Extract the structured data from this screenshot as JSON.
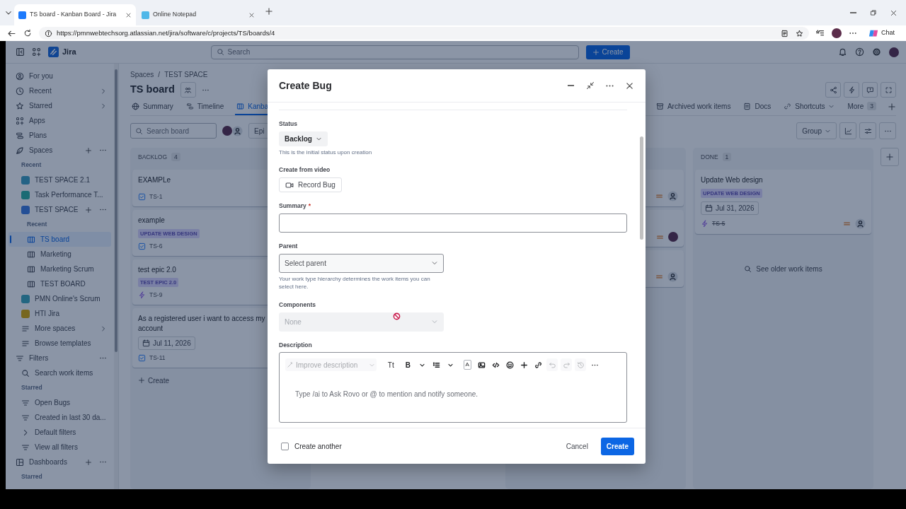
{
  "browser": {
    "tabs": [
      {
        "title": "TS board - Kanban Board - Jira",
        "selected": true
      },
      {
        "title": "Online Notepad",
        "selected": false
      }
    ],
    "url": "https://pmnwebtechsorg.atlassian.net/jira/software/c/projects/TS/boards/4",
    "chat_label": "Chat"
  },
  "topnav": {
    "product": "Jira",
    "search_placeholder": "Search",
    "create_label": "Create"
  },
  "sidebar": {
    "items": [
      {
        "kind": "for-you",
        "label": "For you"
      },
      {
        "kind": "recent",
        "label": "Recent",
        "chevron": true
      },
      {
        "kind": "starred",
        "label": "Starred",
        "chevron": true
      },
      {
        "kind": "apps",
        "label": "Apps"
      },
      {
        "kind": "plans",
        "label": "Plans"
      },
      {
        "kind": "spaces",
        "label": "Spaces",
        "add": true,
        "more": true,
        "children": [
          {
            "kind": "heading",
            "label": "Recent"
          },
          {
            "kind": "space",
            "label": "TEST SPACE 2.1",
            "color": "#236285"
          },
          {
            "kind": "space",
            "label": "Task Performance T...",
            "color": "#1a6b74"
          },
          {
            "kind": "space",
            "label": "TEST SPACE",
            "color": "#244f96",
            "add": true,
            "more": true,
            "children": [
              {
                "kind": "heading",
                "label": "Recent"
              },
              {
                "kind": "board",
                "label": "TS board",
                "selected": true
              },
              {
                "kind": "board",
                "label": "Marketing",
                "selected": false
              },
              {
                "kind": "board",
                "label": "Marketing Scrum",
                "selected": false
              },
              {
                "kind": "board",
                "label": "TEST BOARD",
                "selected": false
              }
            ]
          },
          {
            "kind": "space",
            "label": "PMN Online's Scrum",
            "color": "#236681"
          },
          {
            "kind": "space",
            "label": "HTI Jira",
            "color": "#77671f"
          },
          {
            "kind": "menu",
            "label": "More spaces",
            "chevron": true
          },
          {
            "kind": "menu",
            "label": "Browse templates"
          }
        ]
      },
      {
        "kind": "filters",
        "label": "Filters",
        "more": true,
        "children": [
          {
            "kind": "search",
            "label": "Search work items"
          },
          {
            "kind": "heading",
            "label": "Starred"
          },
          {
            "kind": "filter",
            "label": "Open Bugs"
          },
          {
            "kind": "filter",
            "label": "Created in last 30 da..."
          },
          {
            "kind": "expander",
            "label": "Default filters"
          },
          {
            "kind": "filter",
            "label": "View all filters"
          }
        ]
      },
      {
        "kind": "dashboards",
        "label": "Dashboards",
        "add": true,
        "more": true,
        "children": [
          {
            "kind": "heading",
            "label": "Starred"
          }
        ]
      }
    ]
  },
  "board": {
    "breadcrumb": [
      "Spaces",
      "TEST SPACE"
    ],
    "breadcrumb_separator": "/",
    "title": "TS board",
    "tabs": [
      {
        "label": "Summary",
        "kind": "summary",
        "selected": false
      },
      {
        "label": "Timeline",
        "kind": "timeline",
        "selected": false
      },
      {
        "label": "Kanba",
        "kind": "board",
        "selected": true
      }
    ],
    "tabs_right": [
      {
        "label": "Archived work items",
        "kind": "archive"
      },
      {
        "label": "Docs",
        "kind": "docs"
      },
      {
        "label": "Shortcuts",
        "kind": "shortcuts",
        "dropdown": true
      },
      {
        "label": "More",
        "kind": "more",
        "count": "3"
      }
    ],
    "search_placeholder": "Search board",
    "filter_avatars": [
      {
        "kind": "user"
      },
      {
        "kind": "unassigned"
      }
    ],
    "filter_label": "Epi",
    "group_label": "Group"
  },
  "columns": [
    {
      "title": "BACKLOG",
      "count": "4",
      "create_label": "Create",
      "cards": [
        {
          "summary": "EXAMPLe",
          "kind": "task",
          "key": "TS-1",
          "done": false
        },
        {
          "summary": "example",
          "epic": "UPDATE WEB DESIGN",
          "kind": "task",
          "key": "TS-6",
          "done": false
        },
        {
          "summary": "test epic 2.0",
          "epic": "TEST EPIC 2.0",
          "kind": "epic",
          "key": "TS-9",
          "done": false
        },
        {
          "summary": "As a registered user i want to access my account",
          "due": "Jul 11, 2026",
          "kind": "task",
          "key": "TS-11",
          "done": false
        }
      ]
    },
    {
      "cards": [
        {
          "has_priority": true,
          "assigned": false
        },
        {
          "has_priority": true,
          "assigned": true
        },
        {
          "has_priority": true,
          "assigned": false
        }
      ]
    },
    {
      "title": "DONE",
      "count": "1",
      "footer_link": "See older work items",
      "cards": [
        {
          "summary": "Update Web design",
          "epic": "UPDATE WEB DESIGN",
          "due": "Jul 31, 2026",
          "kind": "epic",
          "key": "TS-5",
          "done": true,
          "has_priority": true,
          "assigned": false
        }
      ]
    }
  ],
  "dialog": {
    "title": "Create Bug",
    "fields": [
      {
        "kind": "status",
        "label": "Status",
        "value": "Backlog",
        "help": "This is the initial status upon creation"
      },
      {
        "kind": "video",
        "label": "Create from video",
        "button": "Record Bug"
      },
      {
        "kind": "text",
        "label": "Summary",
        "required_mark": "*"
      },
      {
        "kind": "select",
        "label": "Parent",
        "placeholder": "Select parent",
        "disabled": false,
        "help": "Your work type hierarchy determines the work items you can select here."
      },
      {
        "kind": "select",
        "label": "Components",
        "value": "None",
        "disabled": true
      },
      {
        "kind": "editor",
        "label": "Description",
        "placeholder": "Type /ai to Ask Rovo or @ to mention and notify someone.",
        "toolbar": [
          {
            "kind": "ai",
            "label": "Improve description",
            "disabled": true
          },
          {
            "kind": "text",
            "label": "Tt",
            "disabled": false
          },
          {
            "kind": "text",
            "label": "B",
            "disabled": false
          },
          {
            "kind": "caret",
            "disabled": false
          },
          {
            "kind": "list",
            "disabled": false
          },
          {
            "kind": "caret",
            "disabled": false
          },
          {
            "kind": "text-color",
            "label": "A",
            "disabled": false
          },
          {
            "kind": "image",
            "disabled": false
          },
          {
            "kind": "code",
            "disabled": false
          },
          {
            "kind": "emoji",
            "disabled": false
          },
          {
            "kind": "insert",
            "disabled": false
          },
          {
            "kind": "link",
            "disabled": false
          },
          {
            "kind": "undo",
            "disabled": true
          },
          {
            "kind": "redo",
            "disabled": true
          },
          {
            "kind": "history",
            "disabled": true
          },
          {
            "kind": "more",
            "disabled": false
          }
        ]
      }
    ],
    "create_another": {
      "label": "Create another",
      "checked": false
    },
    "cancel_label": "Cancel",
    "submit_label": "Create"
  }
}
